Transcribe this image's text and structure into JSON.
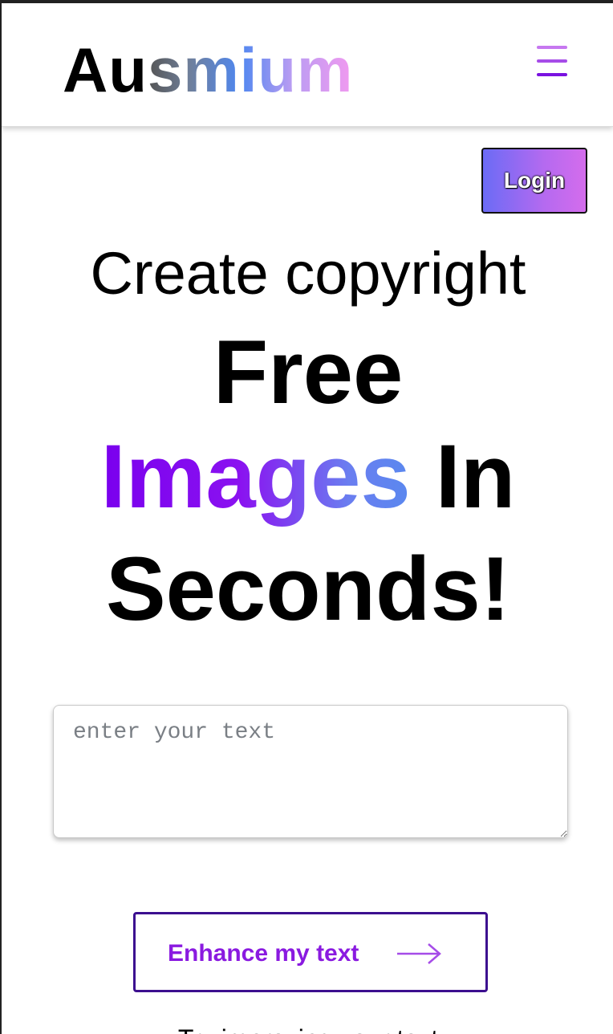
{
  "header": {
    "logo_prefix": "Au",
    "logo_suffix": "smium",
    "menu_icon": "hamburger-menu-icon",
    "menu_colors": [
      "#c678f0",
      "#a64ce8",
      "#7a12e0"
    ]
  },
  "auth": {
    "login_label": "Login"
  },
  "hero": {
    "line1": "Create copyright",
    "line2": "Free",
    "highlight_word": "Images",
    "line3_rest": "In",
    "line4": "Seconds!",
    "highlight_gradient": [
      "#7a00ee",
      "#5a88ef"
    ]
  },
  "prompt": {
    "placeholder": "enter your text",
    "value": ""
  },
  "actions": {
    "enhance_label": "Enhance my text",
    "enhance_icon": "arrow-right-icon",
    "accent_color": "#8a1ae0"
  },
  "footer_hint": {
    "text": "Try improving your text"
  }
}
